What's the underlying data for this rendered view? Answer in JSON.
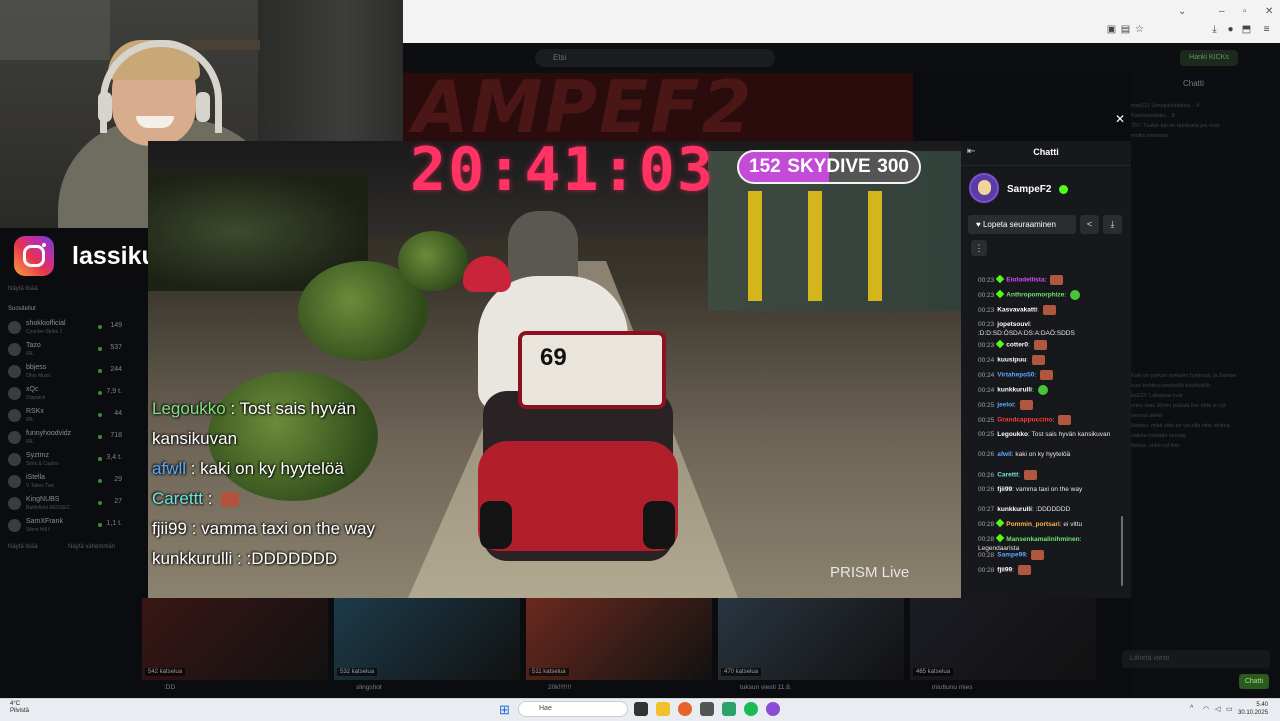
{
  "webcam": {
    "instagram_handle": "lassikuhlman"
  },
  "browser": {
    "search_placeholder": "Etsi",
    "join_button": "Hanki KICKs"
  },
  "stream": {
    "banner_text": "AMPEF2",
    "clock": "20:41:03",
    "skydive": {
      "left": "152",
      "label": "SKYDIVE",
      "right": "300",
      "progress": 0.5
    },
    "scooter_number": "69",
    "watermark": "PRISM Live",
    "overlay_chat": [
      {
        "user": "Legoukko",
        "text": " : Tost sais hyvän",
        "color": "#7fe37f"
      },
      {
        "user": "",
        "text": "kansikuvan",
        "color": "#ffffff"
      },
      {
        "user": "afwll",
        "text": " : kaki on ky hyytelöä",
        "color": "#5aa9ff"
      },
      {
        "user": "Carettt",
        "text": " : ",
        "color": "#6fe3e0",
        "emote": true
      },
      {
        "user": "fjii99",
        "text": " : vamma taxi on the way",
        "color": "#ffffff"
      },
      {
        "user": "kunkkurulli",
        "text": " : :DDDDDDD",
        "color": "#ffffff"
      }
    ]
  },
  "sidebar": {
    "show_more": "Näytä lisää",
    "section": "Suositellut",
    "channels": [
      {
        "name": "shokkiofficial",
        "game": "Counter-Strike 2",
        "count": "149"
      },
      {
        "name": "Tazo",
        "game": "IRL",
        "count": "537"
      },
      {
        "name": "bbjess",
        "game": "Ohio Music",
        "count": "244"
      },
      {
        "name": "xQc",
        "game": "Dispatch",
        "count": "7,9 t."
      },
      {
        "name": "RSKx",
        "game": "IRL",
        "count": "44"
      },
      {
        "name": "funnyhoodvidz",
        "game": "IRL",
        "count": "718"
      },
      {
        "name": "Syztmz",
        "game": "Slots & Casino",
        "count": "3,4 t."
      },
      {
        "name": "iStella",
        "game": "V Takes Two",
        "count": "29"
      },
      {
        "name": "KingNUBS",
        "game": "Battlefield REDSEC",
        "count": "27"
      },
      {
        "name": "SamXFrank",
        "game": "Silent Hill f",
        "count": "1,1 t."
      }
    ],
    "show_more_2": "Näytä lisää",
    "show_less": "Näytä vähemmän"
  },
  "chat_popout": {
    "title": "Chatti",
    "streamer": "SampeF2",
    "follow_button": "Lopeta seuraaminen",
    "messages": [
      {
        "time": "00:23",
        "badge": true,
        "user": "Eiolodellista",
        "color": "#d54cff",
        "text": "",
        "emote": "red"
      },
      {
        "time": "00:23",
        "badge": true,
        "user": "Anthropomorphize",
        "color": "#6fe36f",
        "text": "",
        "emote": "green"
      },
      {
        "time": "00:23",
        "badge": false,
        "user": "Kasvavakatti",
        "color": "#ffffff",
        "text": "",
        "emote": "red"
      },
      {
        "time": "00:23",
        "badge": false,
        "user": "jopetsouvi",
        "color": "#ffffff",
        "text": ":D:D:SD:ÖSDA:DS:A:DAÖ:SDDS",
        "emote": ""
      },
      {
        "time": "00:23",
        "badge": true,
        "user": "cotter0",
        "color": "#ffffff",
        "text": "",
        "emote": "red"
      },
      {
        "time": "00:24",
        "badge": false,
        "user": "kuusipuu",
        "color": "#ffffff",
        "text": "",
        "emote": "red"
      },
      {
        "time": "00:24",
        "badge": false,
        "user": "Virtahepo50",
        "color": "#5aa9ff",
        "text": "",
        "emote": "red"
      },
      {
        "time": "00:24",
        "badge": false,
        "user": "kunkkurulli",
        "color": "#ffffff",
        "text": "",
        "emote": "green"
      },
      {
        "time": "00:25",
        "badge": false,
        "user": "jeeloi",
        "color": "#5aa9ff",
        "text": "",
        "emote": "red"
      },
      {
        "time": "00:25",
        "badge": false,
        "user": "Grandcappuccino",
        "color": "#ff3b3b",
        "text": "",
        "emote": "red"
      },
      {
        "time": "00:25",
        "badge": false,
        "user": "Legoukko",
        "color": "#ffffff",
        "text": "Tost sais hyvän kansikuvan",
        "emote": ""
      },
      {
        "time": "00:26",
        "badge": false,
        "user": "afwll",
        "color": "#5aa9ff",
        "text": "kaki on ky hyytelöä",
        "emote": ""
      },
      {
        "time": "00:26",
        "badge": false,
        "user": "Carettt",
        "color": "#6fe3e0",
        "text": "",
        "emote": "red"
      },
      {
        "time": "00:26",
        "badge": false,
        "user": "fjii99",
        "color": "#ffffff",
        "text": "vamma taxi on the way",
        "emote": ""
      },
      {
        "time": "00:27",
        "badge": false,
        "user": "kunkkurulli",
        "color": "#ffffff",
        "text": ":DDDDDDD",
        "emote": ""
      },
      {
        "time": "00:28",
        "badge": true,
        "user": "Pommin_portsari",
        "color": "#ffb347",
        "text": "ei vittu",
        "emote": ""
      },
      {
        "time": "00:28",
        "badge": true,
        "user": "Mansenkamalinihminen",
        "color": "#6fe36f",
        "text": "Legendaarista",
        "emote": ""
      },
      {
        "time": "00:28",
        "badge": false,
        "user": "Sampe99",
        "color": "#5aa9ff",
        "text": "",
        "emote": "red"
      },
      {
        "time": "00:28",
        "badge": false,
        "user": "fjii99",
        "color": "#ffffff",
        "text": "",
        "emote": "red"
      }
    ]
  },
  "kick_chat": {
    "title": "Chatti",
    "input_placeholder": "Lähetä viesti",
    "send_button": "Chatti",
    "lines": [
      "msp112  Jontajacktatkaa... 4",
      "Kasinopelaaja...  8",
      "797: Tuskin kai on talokoala jos ovat",
      "mutta menossa",
      "Kaki on jonkun meluren hytlessä, ja Sampe",
      "kuul torkkuu penkeillä käytävällä",
      "ka123: Lalvassa ovat",
      "onko taas 10min päästä live mitä ie nyt",
      "seuraa siellä",
      "Naisku: mikä vittu se voi olla ettei striimä",
      "vaikka mistään seuraa",
      "Iiahsa: onko nyt live"
    ]
  },
  "thumbnails": [
    {
      "viewers": "542 katselua",
      "title": ":DD"
    },
    {
      "viewers": "532 katselua",
      "title": "slingshot"
    },
    {
      "viewers": "511 katselua",
      "title": "20k!!!!!!!"
    },
    {
      "viewers": "470 katselua",
      "title": "tuksun viesti 11.8."
    },
    {
      "viewers": "465 katselua",
      "title": "miuttunu mies"
    }
  ],
  "taskbar": {
    "weather_temp": "4°C",
    "weather_desc": "Pilvistä",
    "search": "Hae",
    "time": "5.40",
    "date": "30.10.2025"
  },
  "colors": {
    "kick_green": "#53fc18",
    "clock_pink": "#ff3465",
    "skydive_purple": "#c44bd8"
  }
}
